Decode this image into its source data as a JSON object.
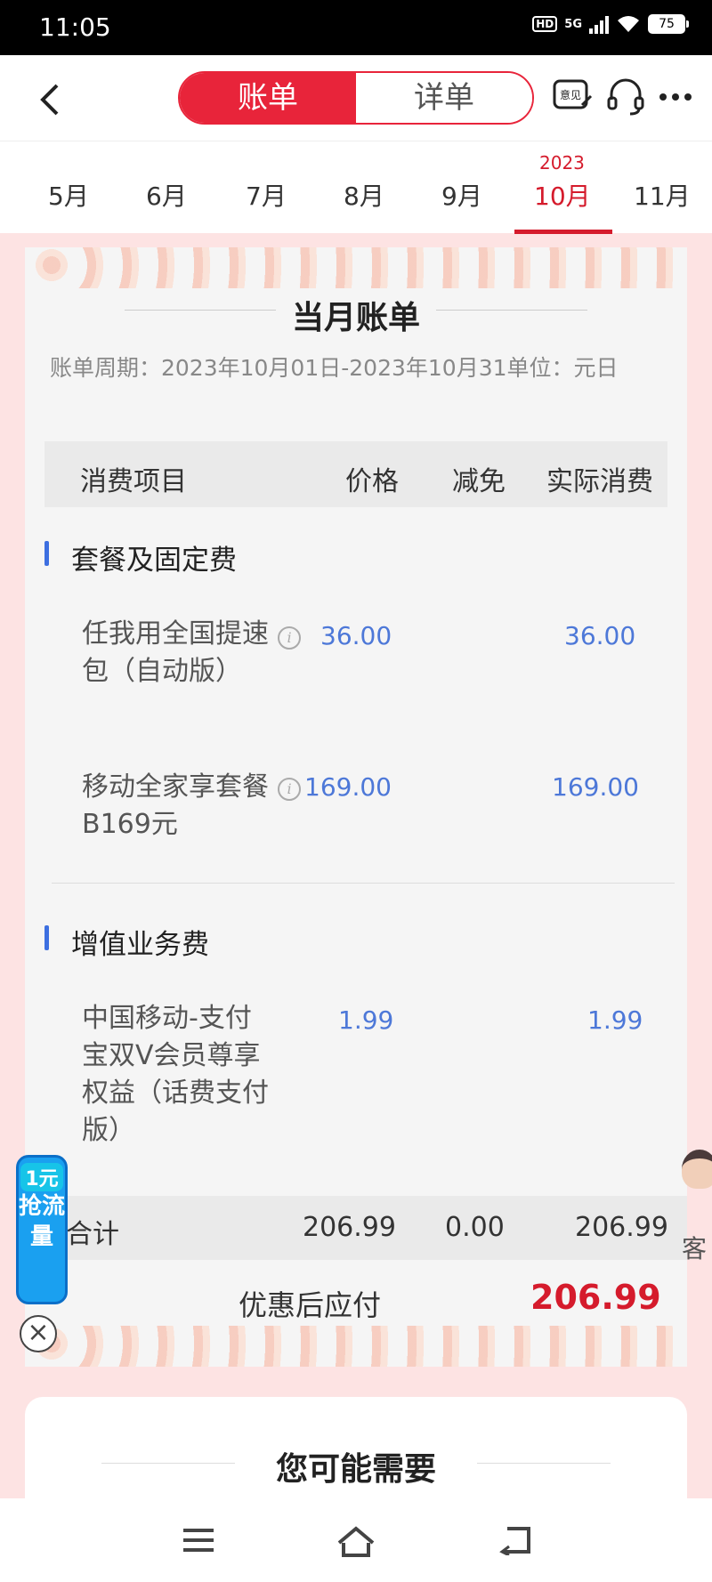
{
  "status": {
    "time": "11:05",
    "hd": "HD",
    "net": "5G",
    "battery": "75"
  },
  "header": {
    "tabs": [
      {
        "label": "账单",
        "active": true
      },
      {
        "label": "详单",
        "active": false
      }
    ],
    "feedback_label": "意见"
  },
  "months": {
    "year": "2023",
    "items": [
      "5月",
      "6月",
      "7月",
      "8月",
      "9月",
      "10月",
      "11月"
    ],
    "active": "10月"
  },
  "bill": {
    "title": "当月账单",
    "period": "账单周期：2023年10月01日-2023年10月31单位：元日",
    "columns": [
      "消费项目",
      "价格",
      "减免",
      "实际消费"
    ],
    "sections": [
      {
        "title": "套餐及固定费",
        "items": [
          {
            "name": "任我用全国提速包（自动版）",
            "price": "36.00",
            "actual": "36.00"
          },
          {
            "name": "移动全家享套餐B169元",
            "price": "169.00",
            "actual": "169.00"
          }
        ]
      },
      {
        "title": "增值业务费",
        "items": [
          {
            "name": "中国移动-支付宝双V会员尊享权益（话费支付版）",
            "price": "1.99",
            "actual": "1.99"
          }
        ]
      }
    ],
    "total": {
      "label": "合计",
      "price": "206.99",
      "discount": "0.00",
      "actual": "206.99"
    },
    "payable": {
      "label": "优惠后应付",
      "value": "206.99"
    }
  },
  "promo": {
    "badge": "1元",
    "text": "抢流量"
  },
  "service": {
    "label": "客"
  },
  "recommend": {
    "title": "您可能需要"
  },
  "colors": {
    "accent": "#e8243a",
    "value_blue": "#4d78d8",
    "section_bar": "#3d6fe0",
    "page_bg": "#fde3e3"
  }
}
